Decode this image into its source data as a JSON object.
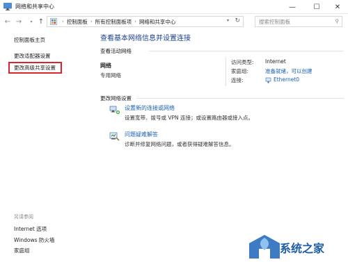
{
  "window": {
    "title": "网络和共享中心",
    "controls": {
      "minimize": "—",
      "maximize": "☐",
      "close": "✕"
    }
  },
  "navigation": {
    "back_glyph": "←",
    "forward_glyph": "→",
    "recent_glyph": "▾",
    "up_glyph": "↑",
    "breadcrumb_sep": "›",
    "breadcrumb": [
      "控制面板",
      "所有控制面板项",
      "网络和共享中心"
    ],
    "dropdown_glyph": "▾",
    "refresh_glyph": "↻",
    "search_placeholder": "搜索控制面板",
    "search_glyph": "⚲"
  },
  "sidebar": {
    "home": "控制面板主页",
    "links": [
      "更改适配器设置",
      "更改高级共享设置"
    ],
    "highlighted_index": 1,
    "highlight_color": "#d9232d",
    "see_also_title": "另请参阅",
    "see_also": [
      "Internet 选项",
      "Windows 防火墙",
      "家庭组"
    ]
  },
  "main": {
    "heading": "查看基本网络信息并设置连接",
    "active_label": "查看活动网络",
    "network_name": "网络",
    "network_category": "专用网络",
    "access_type_label": "访问类型:",
    "access_type_value": "Internet",
    "homegroup_label": "家庭组:",
    "homegroup_value": "准备就绪，可以创建",
    "connection_label": "连接:",
    "connection_value": "Ethernet0",
    "change_settings_label": "更改网络设置",
    "tasks": [
      {
        "icon": "new-connection-icon",
        "link": "设置新的连接或网络",
        "desc": "设置宽带、拨号或 VPN 连接；或设置路由器或接入点。"
      },
      {
        "icon": "troubleshoot-icon",
        "link": "问题疑难解答",
        "desc": "诊断并修复网络问题，或者获得疑难解答信息。"
      }
    ]
  },
  "watermark": {
    "text": "系统之家"
  },
  "colors": {
    "link": "#1a5fb4",
    "heading": "#1a3f8f",
    "watermark": "#1d5da8"
  }
}
